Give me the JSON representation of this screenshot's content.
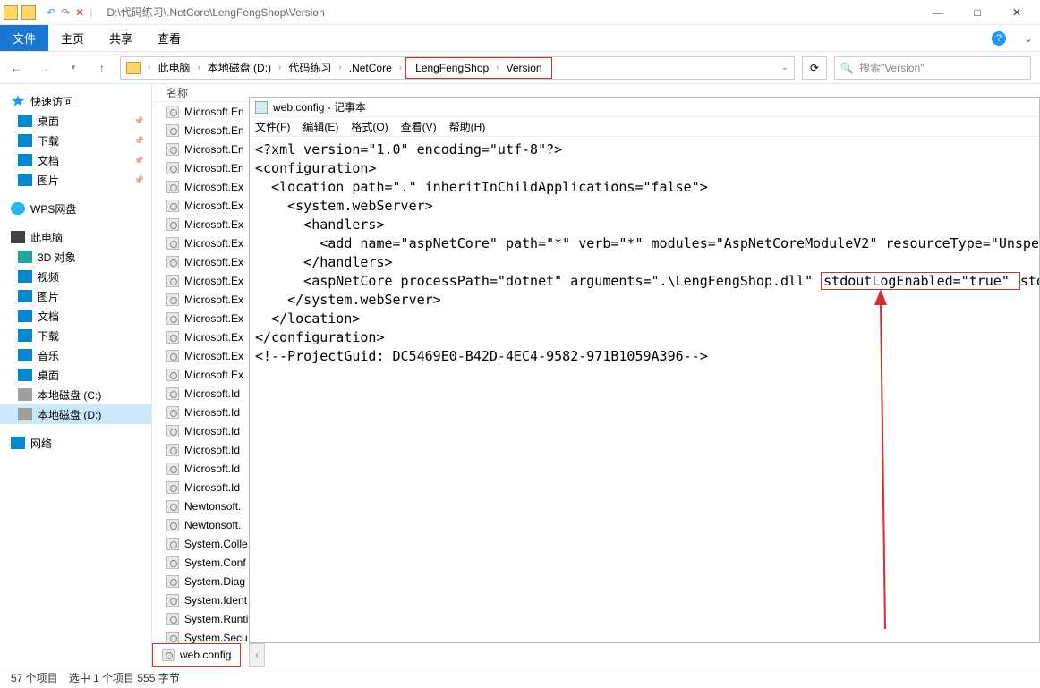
{
  "window": {
    "title_path": "D:\\代码练习\\.NetCore\\LengFengShop\\Version",
    "min": "—",
    "max": "□",
    "close": "✕"
  },
  "quick": {
    "undo": "↶",
    "redo": "↷",
    "del": "✕",
    "divider": "|"
  },
  "tabs": {
    "file": "文件",
    "home": "主页",
    "share": "共享",
    "view": "查看",
    "help": "?"
  },
  "nav": {
    "back": "←",
    "forward": "→",
    "up": "↑",
    "drop": "▾",
    "refresh": "⟳"
  },
  "breadcrumb": {
    "items": [
      "此电脑",
      "本地磁盘 (D:)",
      "代码练习",
      ".NetCore",
      "LengFengShop",
      "Version"
    ],
    "sep": "›"
  },
  "search": {
    "placeholder": "搜索\"Version\"",
    "icon": "🔍"
  },
  "sidebar": {
    "quick_head": "快速访问",
    "quick": [
      "桌面",
      "下载",
      "文档",
      "图片"
    ],
    "wps": "WPS网盘",
    "pc_head": "此电脑",
    "pc": [
      "3D 对象",
      "视频",
      "图片",
      "文档",
      "下载",
      "音乐",
      "桌面",
      "本地磁盘 (C:)",
      "本地磁盘 (D:)"
    ],
    "net": "网络"
  },
  "columns": {
    "name": "名称"
  },
  "files": [
    "Microsoft.En",
    "Microsoft.En",
    "Microsoft.En",
    "Microsoft.En",
    "Microsoft.Ex",
    "Microsoft.Ex",
    "Microsoft.Ex",
    "Microsoft.Ex",
    "Microsoft.Ex",
    "Microsoft.Ex",
    "Microsoft.Ex",
    "Microsoft.Ex",
    "Microsoft.Ex",
    "Microsoft.Ex",
    "Microsoft.Ex",
    "Microsoft.Id",
    "Microsoft.Id",
    "Microsoft.Id",
    "Microsoft.Id",
    "Microsoft.Id",
    "Microsoft.Id",
    "Newtonsoft.",
    "Newtonsoft.",
    "System.Colle",
    "System.Conf",
    "System.Diag",
    "System.Ident",
    "System.Runti",
    "System.Secu"
  ],
  "selected_tab": "web.config",
  "statusbar": {
    "count": "57 个项目",
    "sel": "选中 1 个项目  555 字节"
  },
  "notepad": {
    "title": "web.config - 记事本",
    "menu": [
      "文件(F)",
      "编辑(E)",
      "格式(O)",
      "查看(V)",
      "帮助(H)"
    ],
    "lines": {
      "l1": "<?xml version=\"1.0\" encoding=\"utf-8\"?>",
      "l2": "<configuration>",
      "l3": "  <location path=\".\" inheritInChildApplications=\"false\">",
      "l4": "    <system.webServer>",
      "l5": "      <handlers>",
      "l6": "        <add name=\"aspNetCore\" path=\"*\" verb=\"*\" modules=\"AspNetCoreModuleV2\" resourceType=\"Unspecified\" /",
      "l7": "      </handlers>",
      "l8a": "      <aspNetCore processPath=\"dotnet\" arguments=\".\\LengFengShop.dll\" ",
      "l8b": "stdoutLogEnabled=\"true\" ",
      "l8c": "stdoutLogFile=\"",
      "l9": "    </system.webServer>",
      "l10": "  </location>",
      "l11": "</configuration>",
      "l12": "<!--ProjectGuid: DC5469E0-B42D-4EC4-9582-971B1059A396-->"
    }
  }
}
